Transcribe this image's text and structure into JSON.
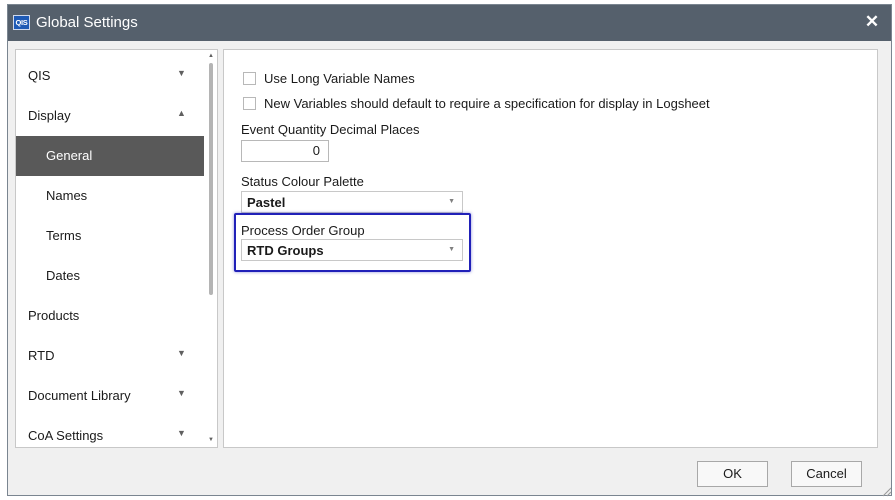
{
  "window": {
    "app_icon_text": "QIS",
    "title": "Global Settings",
    "close_symbol": "✕"
  },
  "sidebar": {
    "items": [
      {
        "label": "QIS",
        "chevron": "▼"
      },
      {
        "label": "Display",
        "chevron": "▲"
      },
      {
        "label": "General",
        "selected": true
      },
      {
        "label": "Names"
      },
      {
        "label": "Terms"
      },
      {
        "label": "Dates"
      },
      {
        "label": "Products"
      },
      {
        "label": "RTD",
        "chevron": "▼"
      },
      {
        "label": "Document Library",
        "chevron": "▼"
      },
      {
        "label": "CoA Settings",
        "chevron": "▼"
      }
    ],
    "scroll_up": "▲",
    "scroll_down": "▼"
  },
  "settings": {
    "long_names": {
      "label": "Use Long Variable Names",
      "checked": false
    },
    "require_spec": {
      "label": "New Variables should default to require a specification for display in Logsheet",
      "checked": false
    },
    "decimal_places": {
      "label": "Event Quantity Decimal Places",
      "value": "0"
    },
    "palette": {
      "label": "Status Colour Palette",
      "value": "Pastel",
      "caret": "▼"
    },
    "process_order_group": {
      "label": "Process Order Group",
      "value": "RTD Groups",
      "caret": "▼"
    }
  },
  "footer": {
    "ok_label": "OK",
    "cancel_label": "Cancel"
  },
  "colors": {
    "titlebar": "#55606c",
    "selected_item": "#595959",
    "highlight_border": "#2020b8"
  }
}
